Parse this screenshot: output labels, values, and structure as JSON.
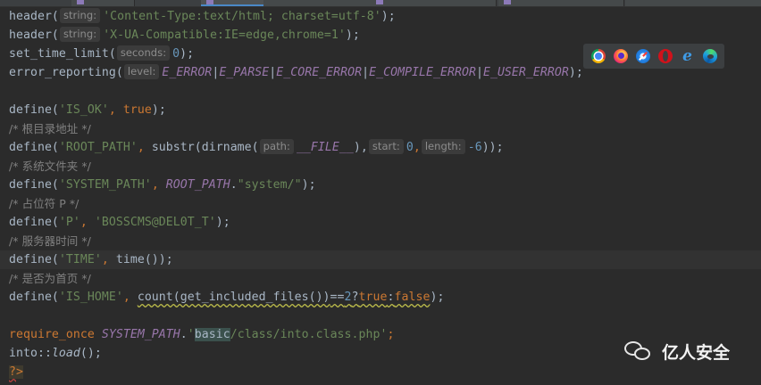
{
  "code_lines": [
    {
      "fn": "header(",
      "hint": "string:",
      "arg": "'Content-Type:text/html; charset=utf-8'",
      "tail": ");"
    },
    {
      "fn": "header(",
      "hint": "string:",
      "arg": "'X-UA-Compatible:IE=edge,chrome=1'",
      "tail": ");"
    },
    {
      "fn": "set_time_limit(",
      "hint": "seconds:",
      "arg": "0",
      "tail": ");"
    },
    {
      "fn": "error_reporting(",
      "hint": "level:",
      "c1": "E_ERROR",
      "c2": "E_PARSE",
      "c3": "E_CORE_ERROR",
      "c4": "E_COMPILE_ERROR",
      "c5": "E_USER_ERROR",
      "sep": "|",
      "tail": ");"
    },
    {
      "text": ""
    },
    {
      "fn": "define(",
      "arg": "'IS_OK'",
      "comma": ", ",
      "kw": "true",
      "tail": ");"
    },
    {
      "comment": "/* 根目录地址 */"
    },
    {
      "fn": "define(",
      "arg": "'ROOT_PATH'",
      "comma": ", ",
      "mid": "substr(dirname(",
      "hint1": "path:",
      "const": "__FILE__",
      "mid2": "),",
      "hint2": "start:",
      "n1": "0",
      "comma2": ",",
      "hint3": "length:",
      "n2": "-6",
      "tail": "));"
    },
    {
      "comment": "/* 系统文件夹 */"
    },
    {
      "fn": "define(",
      "arg": "'SYSTEM_PATH'",
      "comma": ", ",
      "const": "ROOT_PATH",
      "dot": ".",
      "arg2": "\"system/\"",
      "tail": ");"
    },
    {
      "comment": "/* 占位符 P */"
    },
    {
      "fn": "define(",
      "arg": "'P'",
      "comma": ", ",
      "arg2": "'BOSSCMS@DEL0T_T'",
      "tail": ");"
    },
    {
      "comment": "/* 服务器时间 */"
    },
    {
      "fn": "define(",
      "arg": "'TIME'",
      "comma": ", ",
      "mid": "time()",
      "tail": ");"
    },
    {
      "comment": "/* 是否为首页 */"
    },
    {
      "fn": "define(",
      "arg": "'IS_HOME'",
      "comma": ", ",
      "count": "count(get_included_files())",
      "op": "==",
      "n": "2",
      "q": "?",
      "kw1": "true",
      "colon": ":",
      "kw2": "false",
      "tail": ");"
    },
    {
      "text": ""
    },
    {
      "kw": "require_once",
      "const": "SYSTEM_PATH",
      "dot": ".",
      "q_open": "'",
      "match": "basic",
      "rest": "/class/into.class.php'",
      "tail": ";"
    },
    {
      "pre": "into::",
      "method": "load",
      "tail": "();"
    },
    {
      "php_q": "?",
      "php_close": ">"
    }
  ],
  "browser_icons": [
    "chrome-icon",
    "firefox-icon",
    "safari-icon",
    "opera-icon",
    "ie-icon",
    "edge-icon"
  ],
  "ie_glyph": "e",
  "watermark": {
    "icon": "wechat-icon",
    "text": "亿人安全"
  },
  "colors": {
    "background": "#2b2b2b",
    "string": "#6a8759",
    "keyword": "#cc7832",
    "number": "#6897bb",
    "comment": "#808080",
    "constant": "#9876aa",
    "text": "#a9b7c6"
  }
}
